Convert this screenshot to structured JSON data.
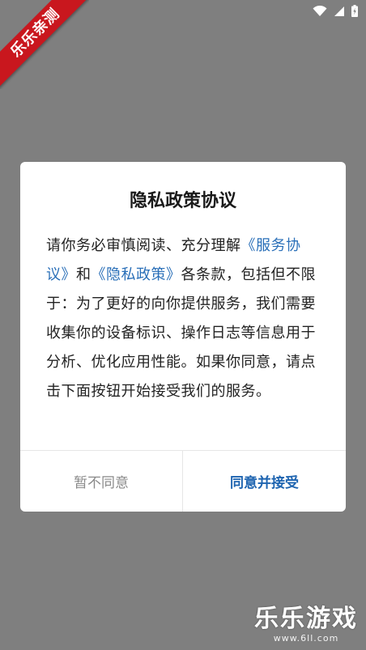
{
  "ribbon": {
    "text": "乐乐亲测"
  },
  "dialog": {
    "title": "隐私政策协议",
    "body": {
      "part1": "请你务必审慎阅读、充分理解",
      "link_service": "《服务协议》",
      "part2": "和",
      "link_privacy": "《隐私政策》",
      "part3": "各条款，包括但不限于：为了更好的向你提供服务，我们需要收集你的设备标识、操作日志等信息用于分析、优化应用性能。如果你同意，请点击下面按钮开始接受我们的服务。"
    },
    "decline_label": "暂不同意",
    "accept_label": "同意并接受"
  },
  "watermark": {
    "main": "乐乐游戏",
    "sub": "www.6ll.com"
  },
  "colors": {
    "overlay": "#7f7f7f",
    "link": "#2a6fb8",
    "accept": "#1e64b0",
    "ribbon": "#c9171e"
  },
  "icons": [
    "wifi-icon",
    "signal-icon",
    "battery-icon"
  ]
}
